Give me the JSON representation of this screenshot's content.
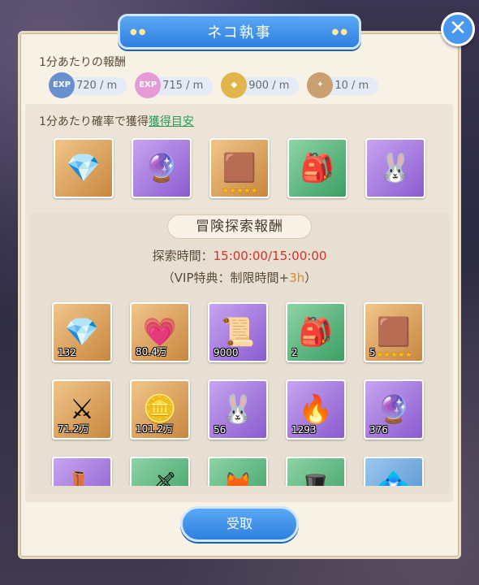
{
  "dialog": {
    "title": "ネコ執事",
    "close_label": "✕"
  },
  "per_minute": {
    "heading": "1分あたりの報酬",
    "rates": [
      {
        "icon": "exp-icon",
        "badge": "EXP",
        "value": "720 / m",
        "color": "#6a8fcf"
      },
      {
        "icon": "pet-exp-icon",
        "badge": "EXP",
        "value": "715 / m",
        "color": "#e69ad6"
      },
      {
        "icon": "gold-coin-icon",
        "badge": "◆",
        "value": "900 / m",
        "color": "#e2b54a"
      },
      {
        "icon": "scroll-icon",
        "badge": "✦",
        "value": "10 / m",
        "color": "#caa070"
      }
    ]
  },
  "chance": {
    "heading": "1分あたり確率で獲得",
    "link": "獲得目安",
    "items": [
      {
        "icon": "crystal-icon",
        "bg": "gold",
        "glyph": "💎"
      },
      {
        "icon": "orb-icon",
        "bg": "purple",
        "glyph": "🔮"
      },
      {
        "icon": "amber-gem-icon",
        "bg": "gold",
        "glyph": "🟫",
        "stars": "★★★★★"
      },
      {
        "icon": "backpack-icon",
        "bg": "green",
        "glyph": "🎒"
      },
      {
        "icon": "spirit-icon",
        "bg": "purple",
        "glyph": "🐰"
      }
    ]
  },
  "explore": {
    "heading": "冒険探索報酬",
    "time_label": "探索時間：",
    "time_value": "15:00:00/15:00:00",
    "vip_prefix": "（VIP特典：制限時間+",
    "vip_value": "3h",
    "vip_suffix": "）",
    "items": [
      {
        "icon": "crystal-icon",
        "bg": "gold",
        "glyph": "💎",
        "count": "132"
      },
      {
        "icon": "pet-exp-icon",
        "bg": "gold",
        "glyph": "💗",
        "count": "80.4万"
      },
      {
        "icon": "scroll-icon",
        "bg": "purple",
        "glyph": "📜",
        "count": "9000"
      },
      {
        "icon": "backpack-icon",
        "bg": "green",
        "glyph": "🎒",
        "count": "2"
      },
      {
        "icon": "amber-gem-icon",
        "bg": "gold",
        "glyph": "🟫",
        "count": "5",
        "stars": "★★★★★"
      },
      {
        "icon": "exp-icon",
        "bg": "gold",
        "glyph": "⚔",
        "count": "71.2万"
      },
      {
        "icon": "gold-coin-icon",
        "bg": "gold",
        "glyph": "🪙",
        "count": "101.2万"
      },
      {
        "icon": "spirit-icon",
        "bg": "purple",
        "glyph": "🐰",
        "count": "56"
      },
      {
        "icon": "flame-icon",
        "bg": "purple",
        "glyph": "🔥",
        "count": "1293"
      },
      {
        "icon": "orb-icon",
        "bg": "purple",
        "glyph": "🔮",
        "count": "376"
      },
      {
        "icon": "boots-icon",
        "bg": "purple",
        "glyph": "👢",
        "count": ""
      },
      {
        "icon": "sword-icon",
        "bg": "green",
        "glyph": "🗡",
        "count": ""
      },
      {
        "icon": "fox-icon",
        "bg": "green",
        "glyph": "🦊",
        "count": ""
      },
      {
        "icon": "hat-icon",
        "bg": "green",
        "glyph": "🎩",
        "count": ""
      },
      {
        "icon": "pendant-icon",
        "bg": "blue",
        "glyph": "💠",
        "count": ""
      }
    ]
  },
  "receive_label": "受取"
}
